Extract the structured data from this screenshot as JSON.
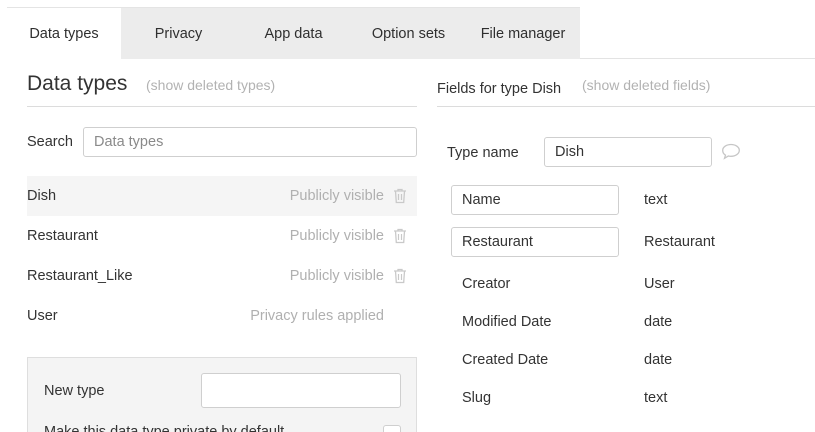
{
  "tabs": [
    {
      "label": "Data types",
      "active": true
    },
    {
      "label": "Privacy",
      "active": false
    },
    {
      "label": "App data",
      "active": false
    },
    {
      "label": "Option sets",
      "active": false
    },
    {
      "label": "File manager",
      "active": false
    }
  ],
  "data_types_panel": {
    "title": "Data types",
    "show_deleted_link": "(show deleted types)",
    "search_label": "Search",
    "search_placeholder": "Data types",
    "search_value": "",
    "types": [
      {
        "name": "Dish",
        "status": "Publicly visible",
        "deletable": true,
        "selected": true
      },
      {
        "name": "Restaurant",
        "status": "Publicly visible",
        "deletable": true,
        "selected": false
      },
      {
        "name": "Restaurant_Like",
        "status": "Publicly visible",
        "deletable": true,
        "selected": false
      },
      {
        "name": "User",
        "status": "Privacy rules applied",
        "deletable": false,
        "selected": false
      }
    ],
    "new_type": {
      "label": "New type",
      "value": "",
      "private_label": "Make this data type private by default",
      "private_checked": false
    }
  },
  "fields_panel": {
    "title": "Fields for type Dish",
    "show_deleted_link": "(show deleted fields)",
    "type_name_label": "Type name",
    "type_name_value": "Dish",
    "fields": [
      {
        "name": "Name",
        "type": "text",
        "editable": true
      },
      {
        "name": "Restaurant",
        "type": "Restaurant",
        "editable": true
      },
      {
        "name": "Creator",
        "type": "User",
        "editable": false
      },
      {
        "name": "Modified Date",
        "type": "date",
        "editable": false
      },
      {
        "name": "Created Date",
        "type": "date",
        "editable": false
      },
      {
        "name": "Slug",
        "type": "text",
        "editable": false
      }
    ]
  },
  "icons": {
    "trash": "trash-icon",
    "comment": "comment-bubble-icon"
  },
  "colors": {
    "tab_inactive_bg": "#ececec",
    "muted_text": "#b0b0b0",
    "selected_row": "#f5f5f5"
  }
}
